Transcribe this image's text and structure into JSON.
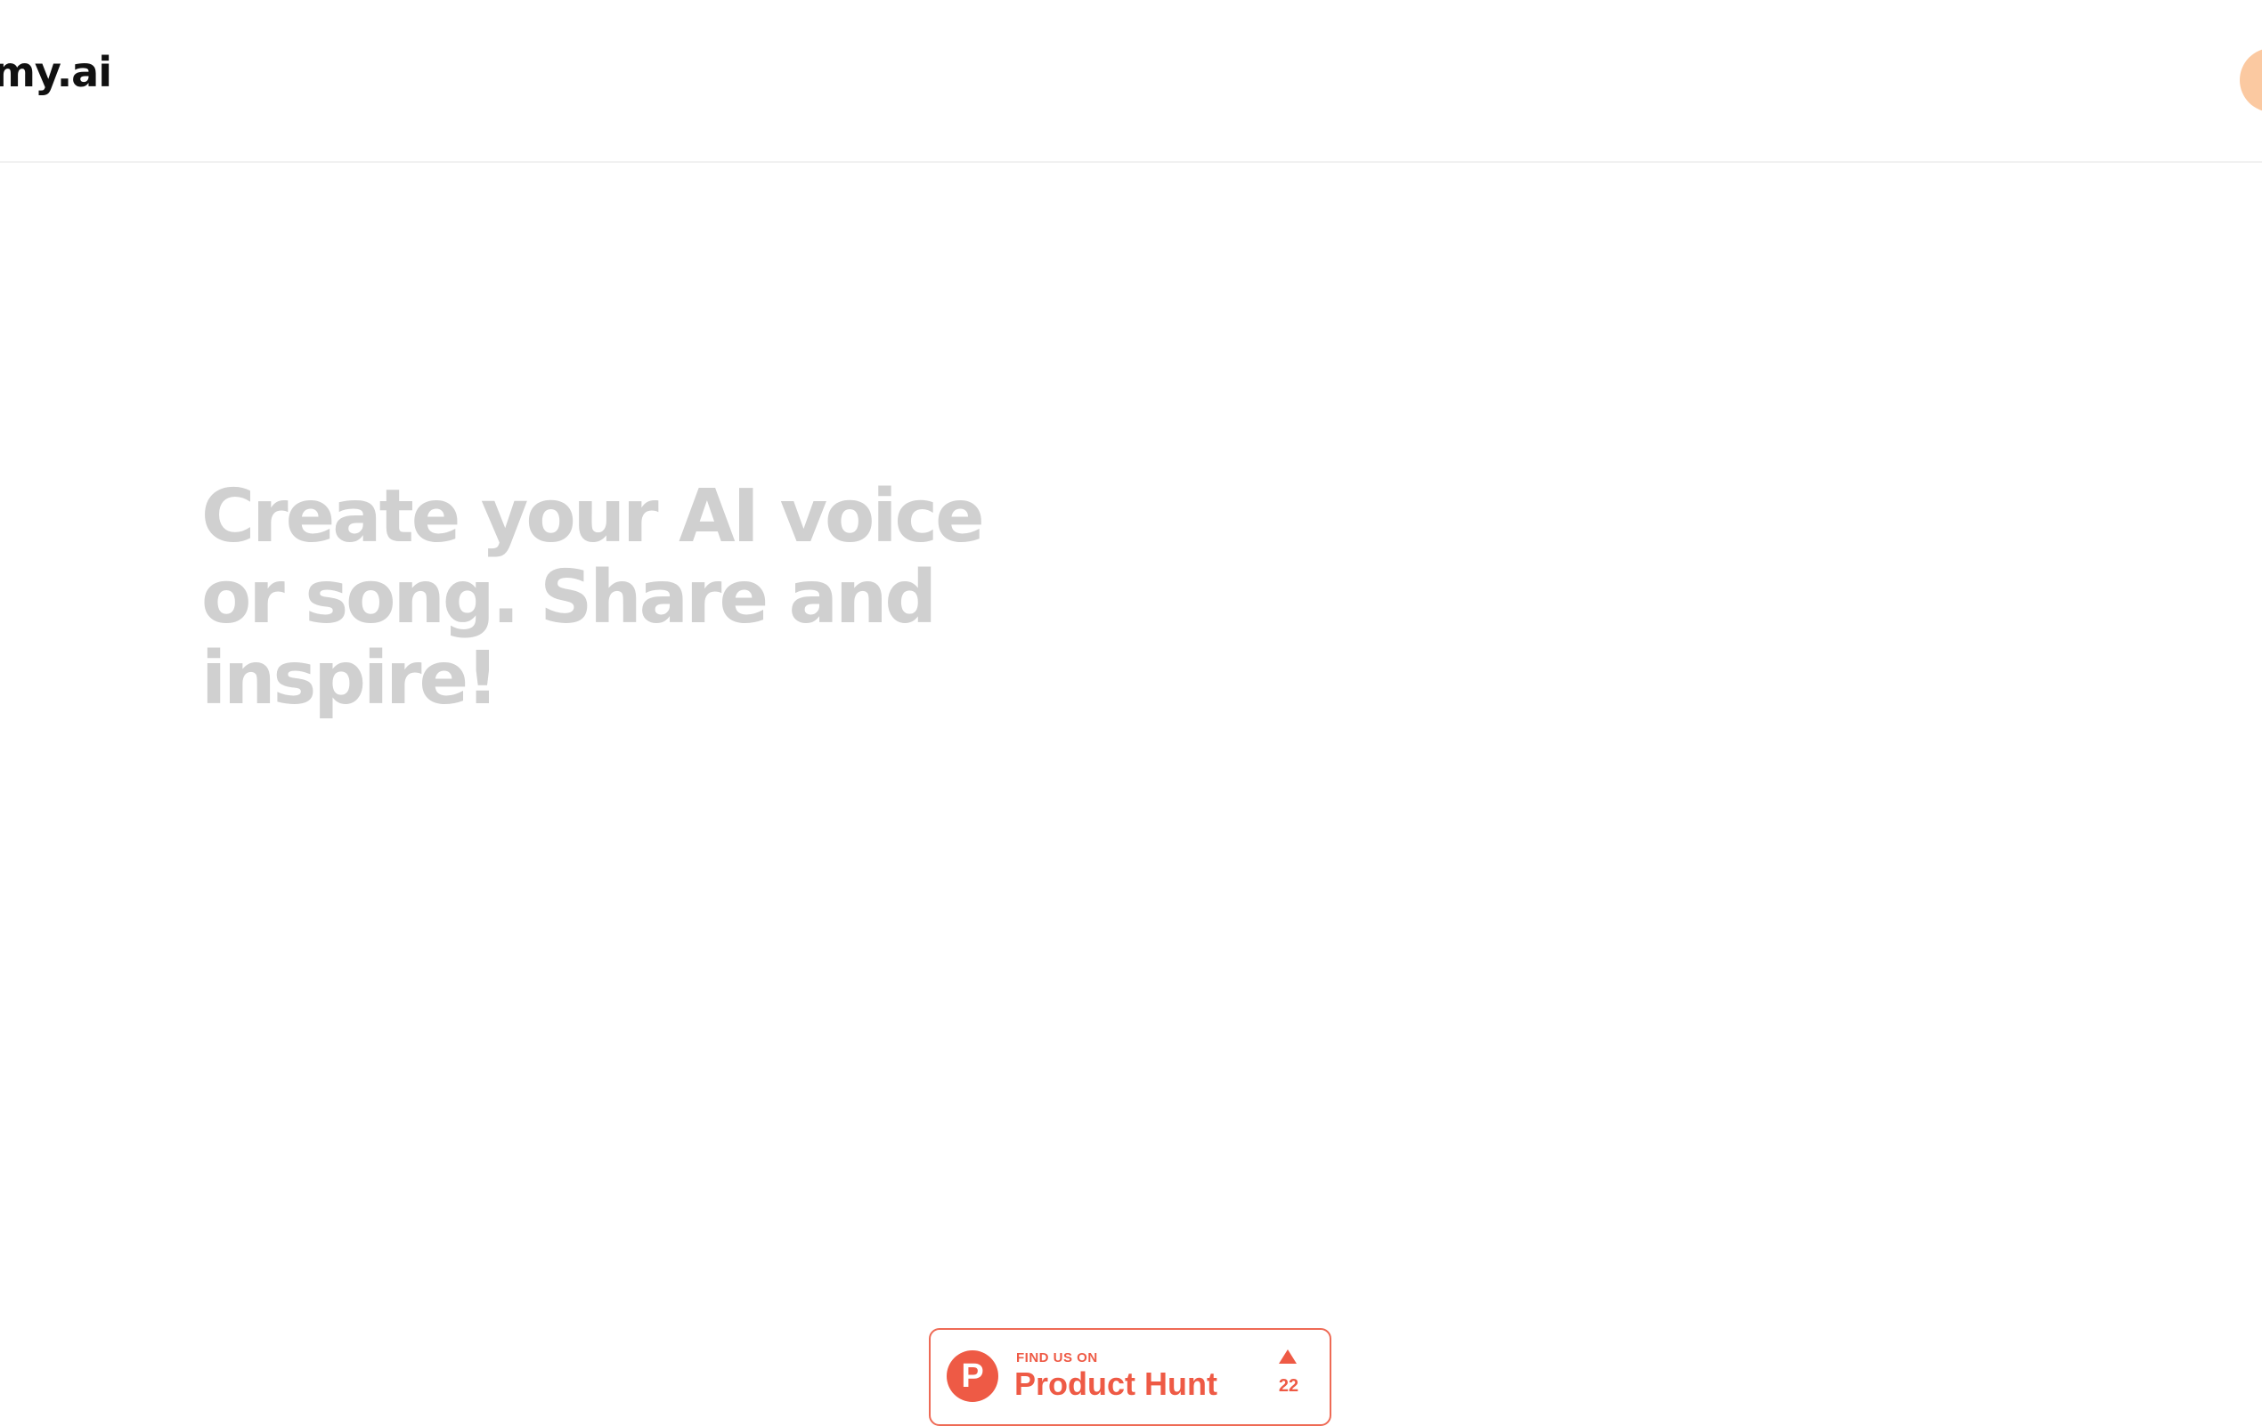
{
  "header": {
    "logo_text": "my.ai"
  },
  "hero": {
    "title": "Create your AI voice or song. Share and inspire!"
  },
  "product_hunt_badge": {
    "prefix": "FIND US ON",
    "name": "Product Hunt",
    "logo_letter": "P",
    "upvotes": "22",
    "icon": "upvote-arrow-icon"
  },
  "colors": {
    "brand_accent": "#ee5a45",
    "avatar": "#fbc9a1",
    "hero_text": "#d0d0d0"
  }
}
